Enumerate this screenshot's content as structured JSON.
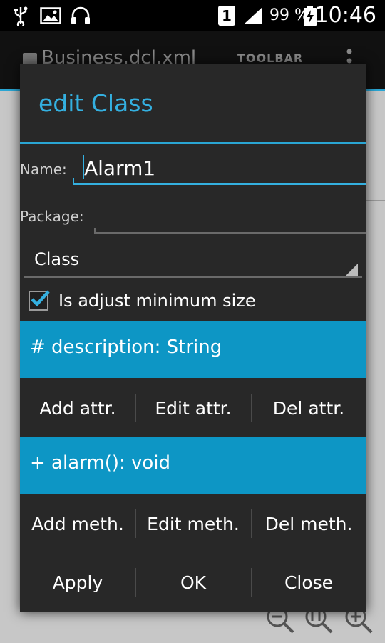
{
  "status_bar": {
    "sim_badge": "1",
    "battery": "99 %",
    "time": "10:46",
    "icons": [
      "usb-icon",
      "image-icon",
      "headphones-icon",
      "signal-icon",
      "battery-charging-icon"
    ]
  },
  "app_bar": {
    "file_title": "Business.dcl.xml",
    "toolbar_label": "TOOLBAR",
    "icons": [
      "app-icon",
      "overflow-menu-icon"
    ]
  },
  "dialog": {
    "title": "edit Class",
    "name_label": "Name:",
    "name_value": "Alarm1",
    "package_label": "Package:",
    "package_value": "",
    "type_value": "Class",
    "adjust_label": "Is adjust minimum size",
    "adjust_checked": true,
    "attribute_item": "# description: String",
    "attr_buttons": [
      "Add attr.",
      "Edit attr.",
      "Del attr."
    ],
    "method_item": "+ alarm(): void",
    "meth_buttons": [
      "Add meth.",
      "Edit meth.",
      "Del meth."
    ],
    "actions": [
      "Apply",
      "OK",
      "Close"
    ]
  },
  "zoom_icons": [
    "zoom-out-icon",
    "zoom-fit-icon",
    "zoom-in-icon"
  ],
  "colors": {
    "accent": "#34b0e0",
    "selected_band": "#0d96c5",
    "dialog_bg": "#282828"
  }
}
